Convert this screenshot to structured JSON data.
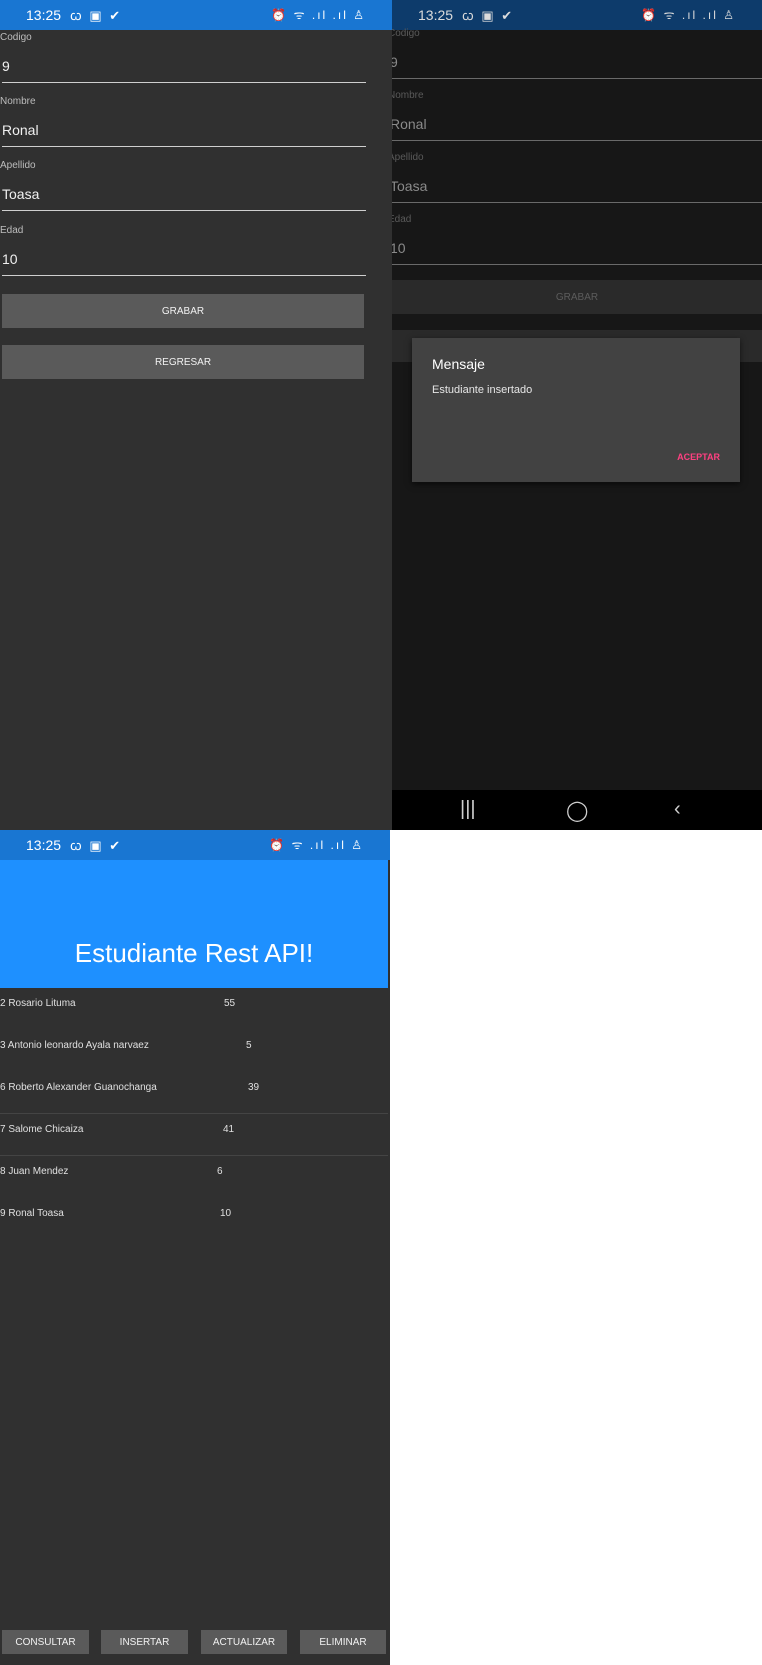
{
  "status_bar": {
    "time": "13:25",
    "left_icons": "ꞷ ▣ ✔",
    "right_icons": "⏰ ᯤ .ıl .ıl ♙"
  },
  "form": {
    "fields": [
      {
        "label": "Codigo",
        "value": "9"
      },
      {
        "label": "Nombre",
        "value": "Ronal"
      },
      {
        "label": "Apellido",
        "value": "Toasa"
      },
      {
        "label": "Edad",
        "value": "10"
      }
    ],
    "save_label": "GRABAR",
    "back_label": "REGRESAR"
  },
  "dialog": {
    "title": "Mensaje",
    "message": "Estudiante insertado",
    "accept_label": "ACEPTAR"
  },
  "nav_bar": {
    "recent": "|||",
    "home": "◯",
    "back": "‹"
  },
  "list_screen": {
    "title": "Estudiante Rest API!",
    "students": [
      {
        "name": "2 Rosario  Lituma",
        "age": "55"
      },
      {
        "name": "3 Antonio leonardo  Ayala narvaez",
        "age": "5"
      },
      {
        "name": "6 Roberto Alexander  Guanochanga",
        "age": "39"
      },
      {
        "name": "7 Salome  Chicaiza",
        "age": "41"
      },
      {
        "name": "8 Juan  Mendez",
        "age": "6"
      },
      {
        "name": "9 Ronal  Toasa",
        "age": "10"
      }
    ],
    "buttons": {
      "consultar": "CONSULTAR",
      "insertar": "INSERTAR",
      "actualizar": "ACTUALIZAR",
      "eliminar": "ELIMINAR"
    }
  }
}
